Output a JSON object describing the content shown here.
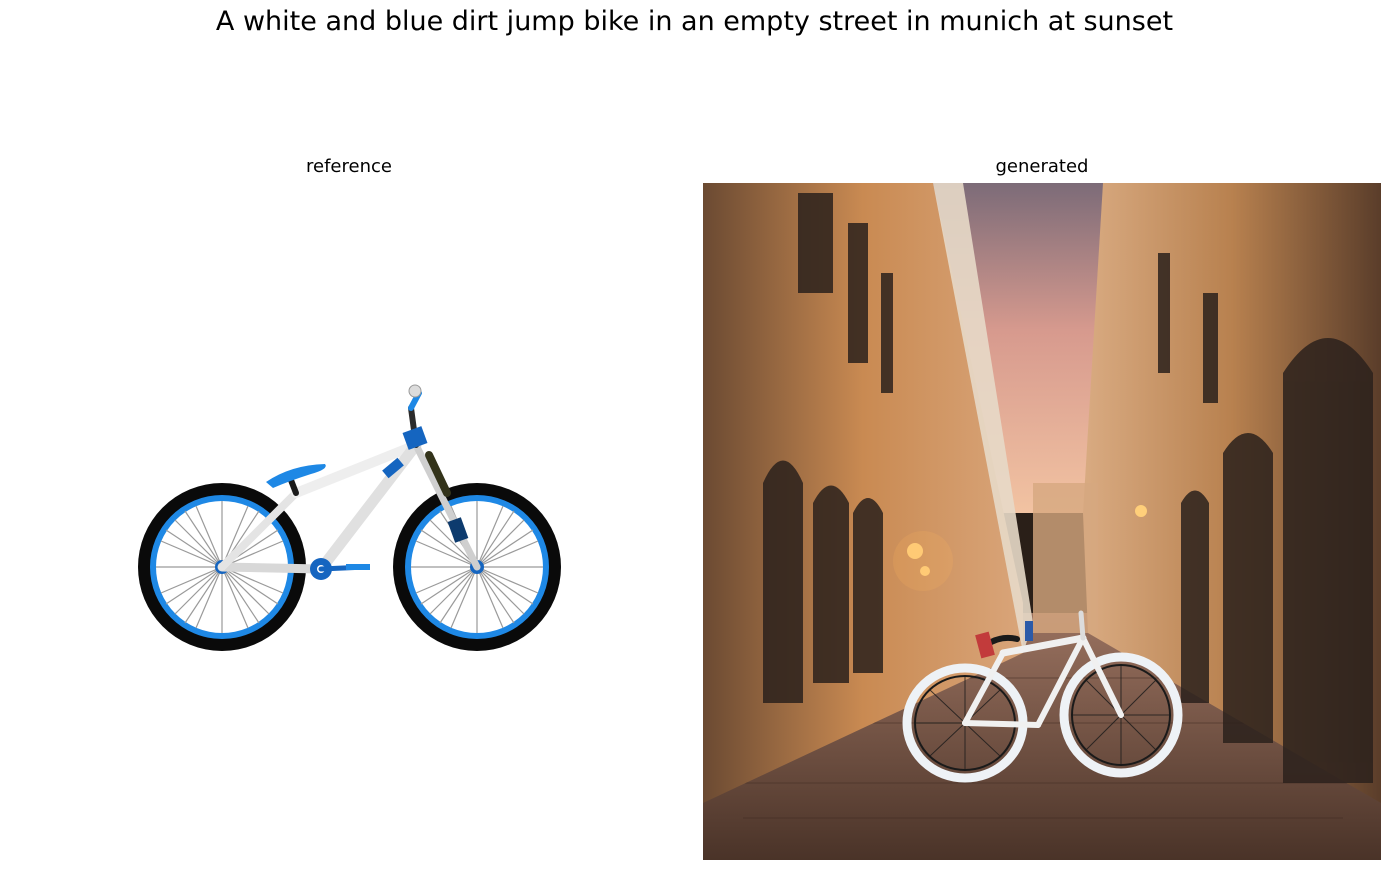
{
  "figure": {
    "title": "A white and blue dirt jump bike in an empty street in munich at sunset"
  },
  "panels": [
    {
      "id": "reference",
      "title": "reference"
    },
    {
      "id": "generated",
      "title": "generated"
    }
  ],
  "colors": {
    "bike_blue": "#1e88e5",
    "tire_black": "#0a0a0a",
    "frame_white": "#f2f2f2",
    "facade_orange": "#c98a52",
    "sky_pink": "#e8a996",
    "cobblestone": "#6b4a3a"
  }
}
